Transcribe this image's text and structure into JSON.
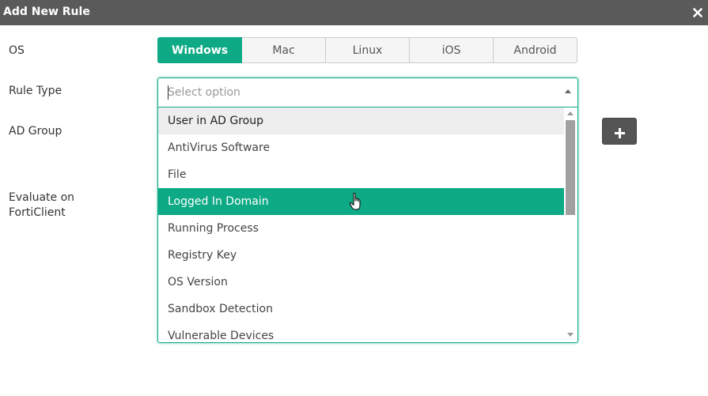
{
  "dialog": {
    "title": "Add New Rule",
    "close_icon": "close-icon"
  },
  "form": {
    "os_label": "OS",
    "rule_type_label": "Rule Type",
    "ad_group_label": "AD Group",
    "evaluate_label_line1": "Evaluate on",
    "evaluate_label_line2": "FortiClient"
  },
  "os_options": {
    "selected": "Windows",
    "items": [
      "Windows",
      "Mac",
      "Linux",
      "iOS",
      "Android"
    ]
  },
  "rule_type": {
    "placeholder": "Select option",
    "options": [
      "User in AD Group",
      "AntiVirus Software",
      "File",
      "Logged In Domain",
      "Running Process",
      "Registry Key",
      "OS Version",
      "Sandbox Detection",
      "Vulnerable Devices"
    ],
    "hovered": "User in AD Group",
    "highlighted": "Logged In Domain"
  },
  "ad_group": {
    "add_icon": "plus-icon"
  },
  "colors": {
    "accent": "#0eaa85",
    "titlebar": "#5a5a5a",
    "add_button": "#555555"
  }
}
